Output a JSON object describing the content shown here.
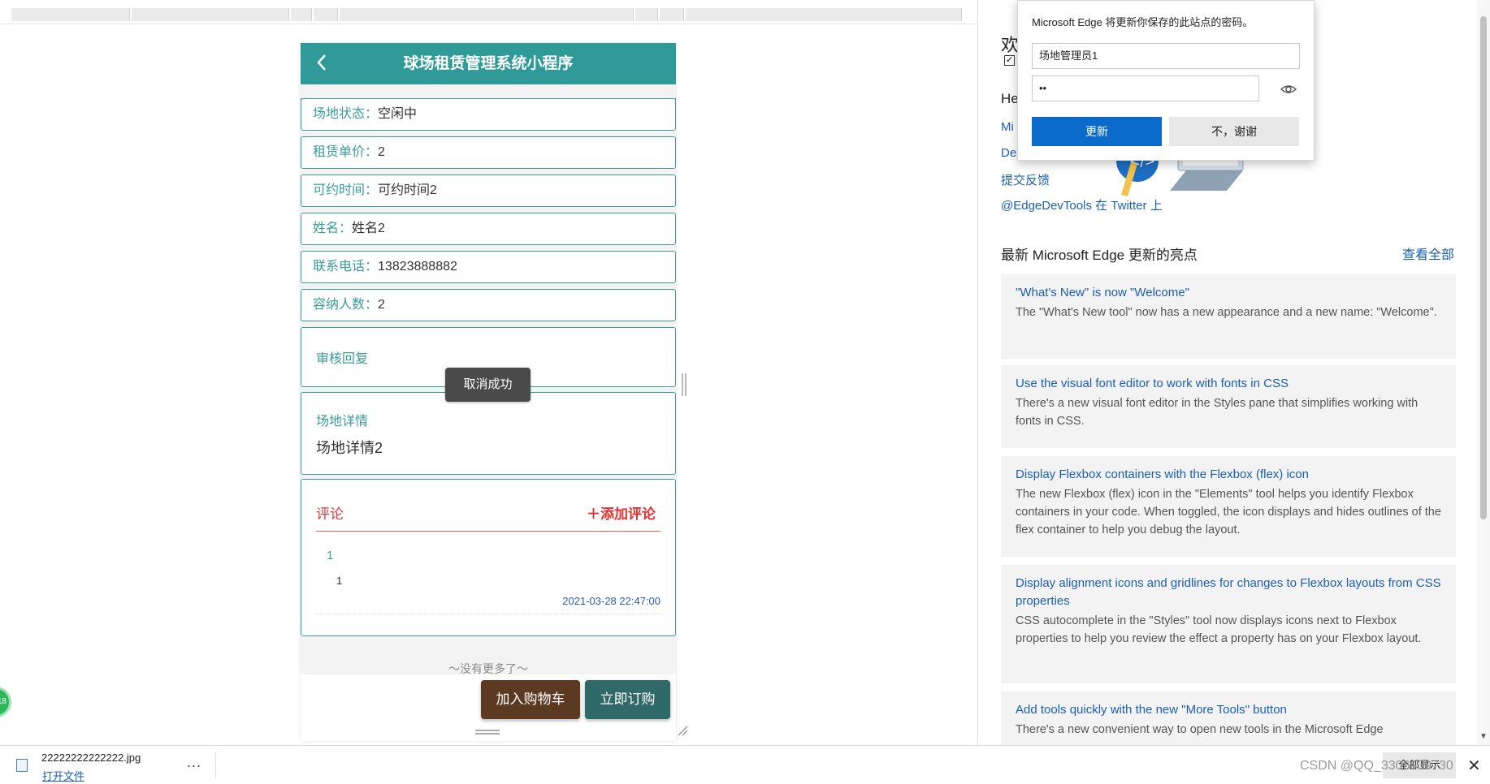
{
  "app": {
    "title": "球场租赁管理系统小程序"
  },
  "fields": [
    {
      "label": "场地状态：",
      "value": "空闲中"
    },
    {
      "label": "租赁单价：",
      "value": "2"
    },
    {
      "label": "可约时间：",
      "value": "可约时间2"
    },
    {
      "label": "姓名：",
      "value": "姓名2"
    },
    {
      "label": "联系电话：",
      "value": "13823888882"
    },
    {
      "label": "容纳人数：",
      "value": "2"
    }
  ],
  "review": {
    "caption": "审核回复"
  },
  "toast": "取消成功",
  "details": {
    "caption": "场地详情",
    "text": "场地详情2"
  },
  "comments": {
    "heading": "评论",
    "add_label": "＋添加评论",
    "items": [
      {
        "user": "1",
        "text": "1",
        "time": "2021-03-28 22:47:00"
      }
    ]
  },
  "no_more": "～没有更多了～",
  "actions": {
    "cart": "加入购物车",
    "buy": "立即订购"
  },
  "devtools": {
    "partial_welcome": "欢",
    "partial_he": "He",
    "partial_mi": "Mi",
    "partial_de": "De",
    "feedback_link": "提交反馈",
    "twitter_link": "@EdgeDevTools 在 Twitter 上",
    "section_title": "最新 Microsoft Edge 更新的亮点",
    "see_all": "查看全部",
    "cards": [
      {
        "title": "\"What's New\" is now \"Welcome\"",
        "desc": "The \"What's New tool\" now has a new appearance and a new name: \"Welcome\"."
      },
      {
        "title": "Use the visual font editor to work with fonts in CSS",
        "desc": "There's a new visual font editor in the Styles pane that simplifies working with fonts in CSS."
      },
      {
        "title": "Display Flexbox containers with the Flexbox (flex) icon",
        "desc": "The new Flexbox (flex) icon in the \"Elements\" tool helps you identify Flexbox containers in your code. When toggled, the icon displays and hides outlines of the flex container to help you debug the layout."
      },
      {
        "title": "Display alignment icons and gridlines for changes to Flexbox layouts from CSS properties",
        "desc": "CSS autocomplete in the \"Styles\" tool now displays icons next to Flexbox properties to help you review the effect a property has on your Flexbox layout."
      },
      {
        "title": "Add tools quickly with the new \"More Tools\" button",
        "desc": "There's a new convenient way to open new tools in the Microsoft Edge"
      }
    ]
  },
  "password_popup": {
    "message": "Microsoft Edge 将更新你保存的此站点的密码。",
    "username": "场地管理员1",
    "password_mask": "••",
    "update_label": "更新",
    "decline_label": "不，谢谢"
  },
  "download": {
    "filename": "22222222222222.jpg",
    "open_label": "打开文件",
    "more_label": "...",
    "show_all": "全部显示",
    "close_glyph": "✕"
  },
  "watermark": "CSDN @QQ_3306639730",
  "badge": "18",
  "colors": {
    "accent": "#2f9a98",
    "cart": "#5b3a21",
    "buy": "#2f6a68",
    "edge_blue": "#0b6bcb"
  }
}
